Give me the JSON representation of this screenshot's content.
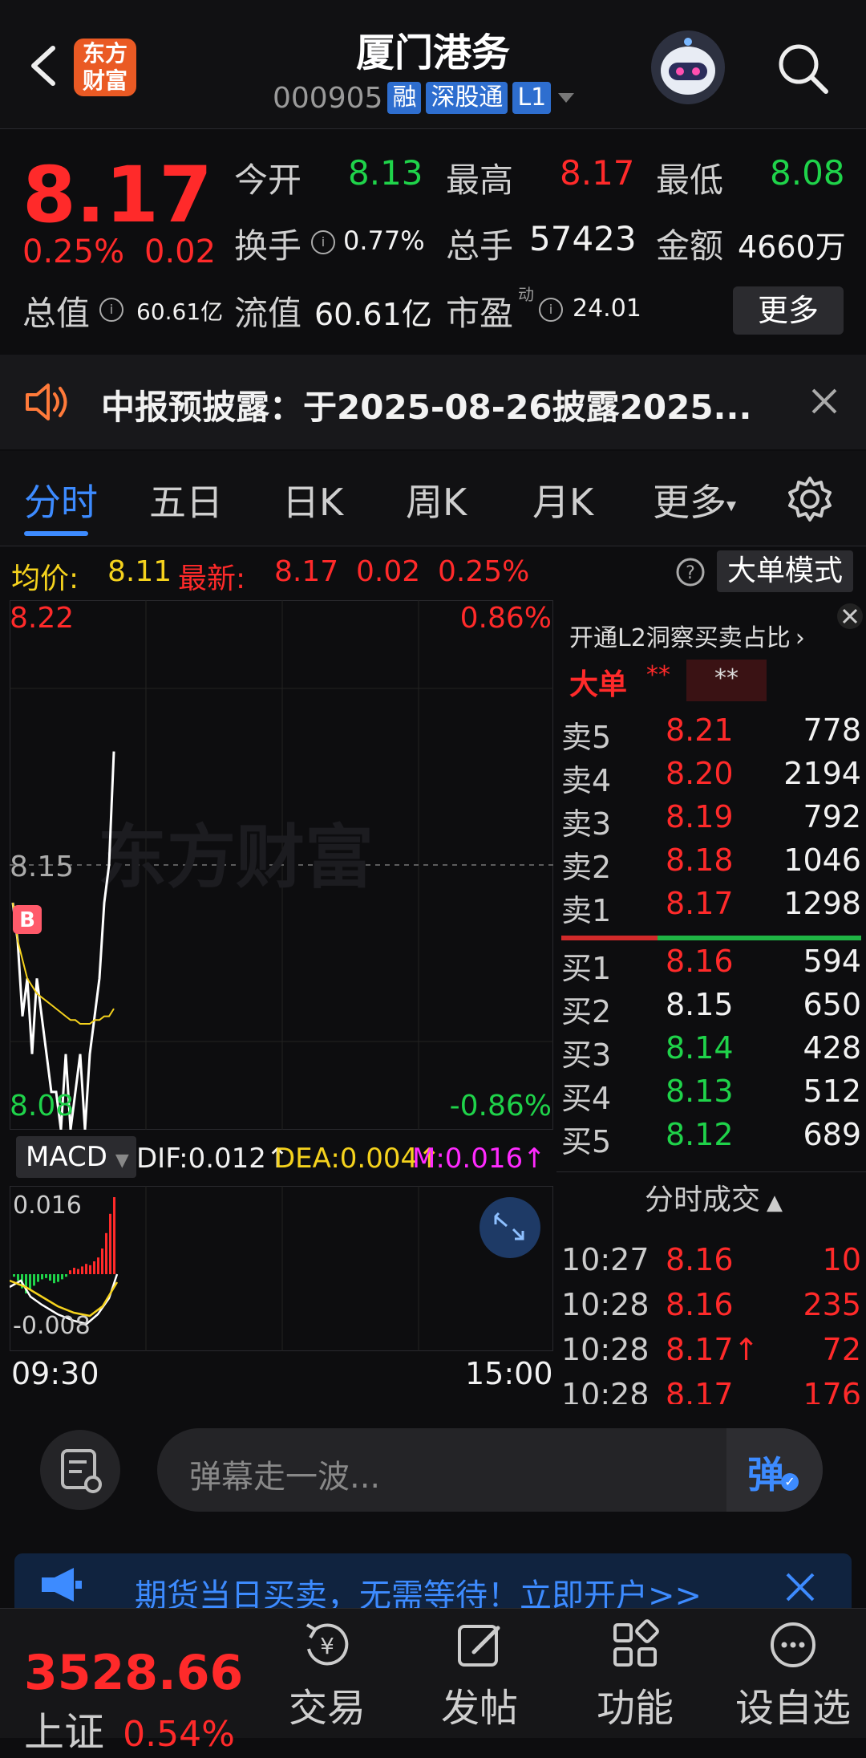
{
  "header": {
    "logo_text": "东方财富",
    "title": "厦门港务",
    "code": "000905",
    "tags": [
      "融",
      "深股通",
      "L1"
    ]
  },
  "quote": {
    "price": "8.17",
    "change_pct": "0.25%",
    "change": "0.02",
    "open_label": "今开",
    "open": "8.13",
    "high_label": "最高",
    "high": "8.17",
    "low_label": "最低",
    "low": "8.08",
    "turnover_label": "换手",
    "turnover": "0.77%",
    "volume_label": "总手",
    "volume": "57423",
    "amount_label": "金额",
    "amount": "4660万",
    "mcap_label": "总值",
    "mcap": "60.61亿",
    "float_label": "流值",
    "float": "60.61亿",
    "pe_label": "市盈",
    "pe_sup": "动",
    "pe": "24.01",
    "more_label": "更多"
  },
  "notice": {
    "text": "中报预披露：于2025-08-26披露2025..."
  },
  "tabs": [
    "分时",
    "五日",
    "日K",
    "周K",
    "月K",
    "更多"
  ],
  "avg_row": {
    "avg_label": "均价:",
    "avg": "8.11",
    "latest_label": "最新:",
    "latest": "8.17",
    "change": "0.02",
    "pct": "0.25%",
    "mode_label": "大单模式"
  },
  "chart": {
    "y_top": "8.22",
    "y_mid": "8.15",
    "y_bottom": "8.08",
    "pct_top": "0.86%",
    "pct_bottom": "-0.86%",
    "watermark": "东方财富",
    "b_marker": "B",
    "x_start": "09:30",
    "x_end": "15:00"
  },
  "chart_data": {
    "type": "line",
    "title": "",
    "ylim": [
      8.08,
      8.22
    ],
    "series": [
      {
        "values": [
          8.14,
          8.13,
          8.11,
          8.12,
          8.1,
          8.12,
          8.11,
          8.1,
          8.09,
          8.09,
          8.08,
          8.1,
          8.08,
          8.09,
          8.1,
          8.08,
          8.1,
          8.11,
          8.12,
          8.14,
          8.15,
          8.18
        ]
      },
      {
        "values": [
          8.14,
          8.13,
          8.125,
          8.12,
          8.118,
          8.116,
          8.115,
          8.114,
          8.113,
          8.112,
          8.111,
          8.11,
          8.109,
          8.109,
          8.108,
          8.108,
          8.108,
          8.109,
          8.109,
          8.11,
          8.11,
          8.112
        ]
      }
    ]
  },
  "macd": {
    "name": "MACD",
    "dif": "DIF:0.012↑",
    "dea": "DEA:0.004↑",
    "m": "M:0.016↑",
    "top": "0.016",
    "bottom": "-0.008"
  },
  "book": {
    "l2_link": "开通L2洞察买卖占比",
    "big_label": "大单",
    "big_v1": "**",
    "big_v2": "**",
    "asks": [
      {
        "label": "卖5",
        "price": "8.21",
        "vol": "778"
      },
      {
        "label": "卖4",
        "price": "8.20",
        "vol": "2194"
      },
      {
        "label": "卖3",
        "price": "8.19",
        "vol": "792"
      },
      {
        "label": "卖2",
        "price": "8.18",
        "vol": "1046"
      },
      {
        "label": "卖1",
        "price": "8.17",
        "vol": "1298"
      }
    ],
    "bids": [
      {
        "label": "买1",
        "price": "8.16",
        "vol": "594"
      },
      {
        "label": "买2",
        "price": "8.15",
        "vol": "650"
      },
      {
        "label": "买3",
        "price": "8.14",
        "vol": "428"
      },
      {
        "label": "买4",
        "price": "8.13",
        "vol": "512"
      },
      {
        "label": "买5",
        "price": "8.12",
        "vol": "689"
      }
    ],
    "trades_label": "分时成交",
    "trades": [
      {
        "time": "10:27",
        "price": "8.16",
        "vol": "10"
      },
      {
        "time": "10:28",
        "price": "8.16",
        "vol": "235"
      },
      {
        "time": "10:28",
        "price": "8.17↑",
        "vol": "72"
      },
      {
        "time": "10:28",
        "price": "8.17",
        "vol": "176"
      }
    ]
  },
  "danmu": {
    "placeholder": "弹幕走一波...",
    "send_label": "弹"
  },
  "ad": {
    "text": "期货当日买卖，无需等待！立即开户>>"
  },
  "tabbar": {
    "index_value": "3528.66",
    "index_name": "上证",
    "index_pct": "0.54%",
    "items": [
      "交易",
      "发帖",
      "功能",
      "设自选"
    ]
  },
  "colors": {
    "up": "#ff2a2a",
    "down": "#1fd34a",
    "accent": "#3d8bff",
    "avg": "#f5d21d"
  }
}
